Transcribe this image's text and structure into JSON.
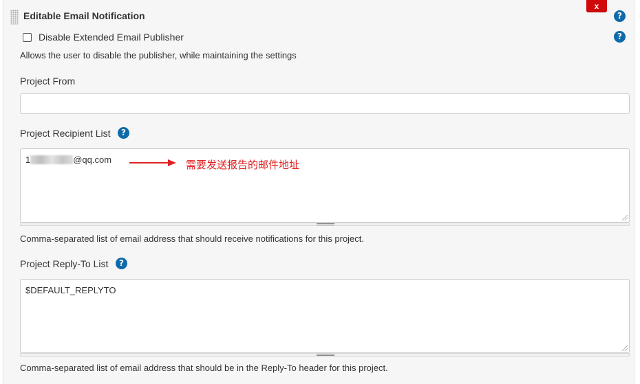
{
  "section": {
    "title": "Editable Email Notification",
    "delete_label": "x"
  },
  "disable_publisher": {
    "label": "Disable Extended Email Publisher",
    "checked": false,
    "description": "Allows the user to disable the publisher, while maintaining the settings"
  },
  "project_from": {
    "label": "Project From",
    "value": ""
  },
  "recipient_list": {
    "label": "Project Recipient List",
    "value_prefix": "1",
    "value_suffix": "@qq.com",
    "description": "Comma-separated list of email address that should receive notifications for this project."
  },
  "annotation": {
    "text": "需要发送报告的邮件地址",
    "color": "#e02020"
  },
  "reply_to": {
    "label": "Project Reply-To List",
    "value": "$DEFAULT_REPLYTO",
    "description": "Comma-separated list of email address that should be in the Reply-To header for this project."
  },
  "help_icon_glyph": "?",
  "colors": {
    "help": "#0e6aa8",
    "delete": "#d00a0a"
  }
}
